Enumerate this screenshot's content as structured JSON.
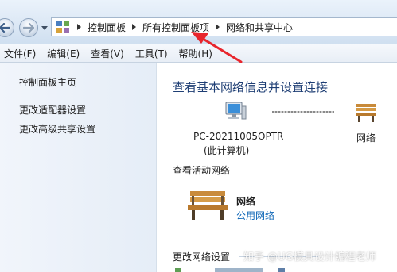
{
  "breadcrumb": [
    "控制面板",
    "所有控制面板项",
    "网络和共享中心"
  ],
  "icons": {
    "back": "back-arrow-icon",
    "forward": "forward-arrow-icon",
    "control_panel": "control-panel-icon",
    "computer": "computer-icon",
    "network": "bench-network-icon"
  },
  "menu": [
    "文件(F)",
    "编辑(E)",
    "查看(V)",
    "工具(T)",
    "帮助(H)"
  ],
  "left_links": [
    "控制面板主页",
    "更改适配器设置",
    "更改高级共享设置"
  ],
  "main": {
    "title": "查看基本网络信息并设置连接",
    "computer_name": "PC-20211005OPTR",
    "computer_sub": "(此计算机)",
    "network_label": "网络",
    "active_section": "查看活动网络",
    "active_network_name": "网络",
    "active_network_type": "公用网络",
    "change_section": "更改网络设置"
  },
  "watermark": "知乎 @UG模具设计编程老师",
  "colors": {
    "title_blue": "#1e3e74",
    "link_blue": "#0c65b6",
    "annotation_arrow": "#e8262d"
  }
}
